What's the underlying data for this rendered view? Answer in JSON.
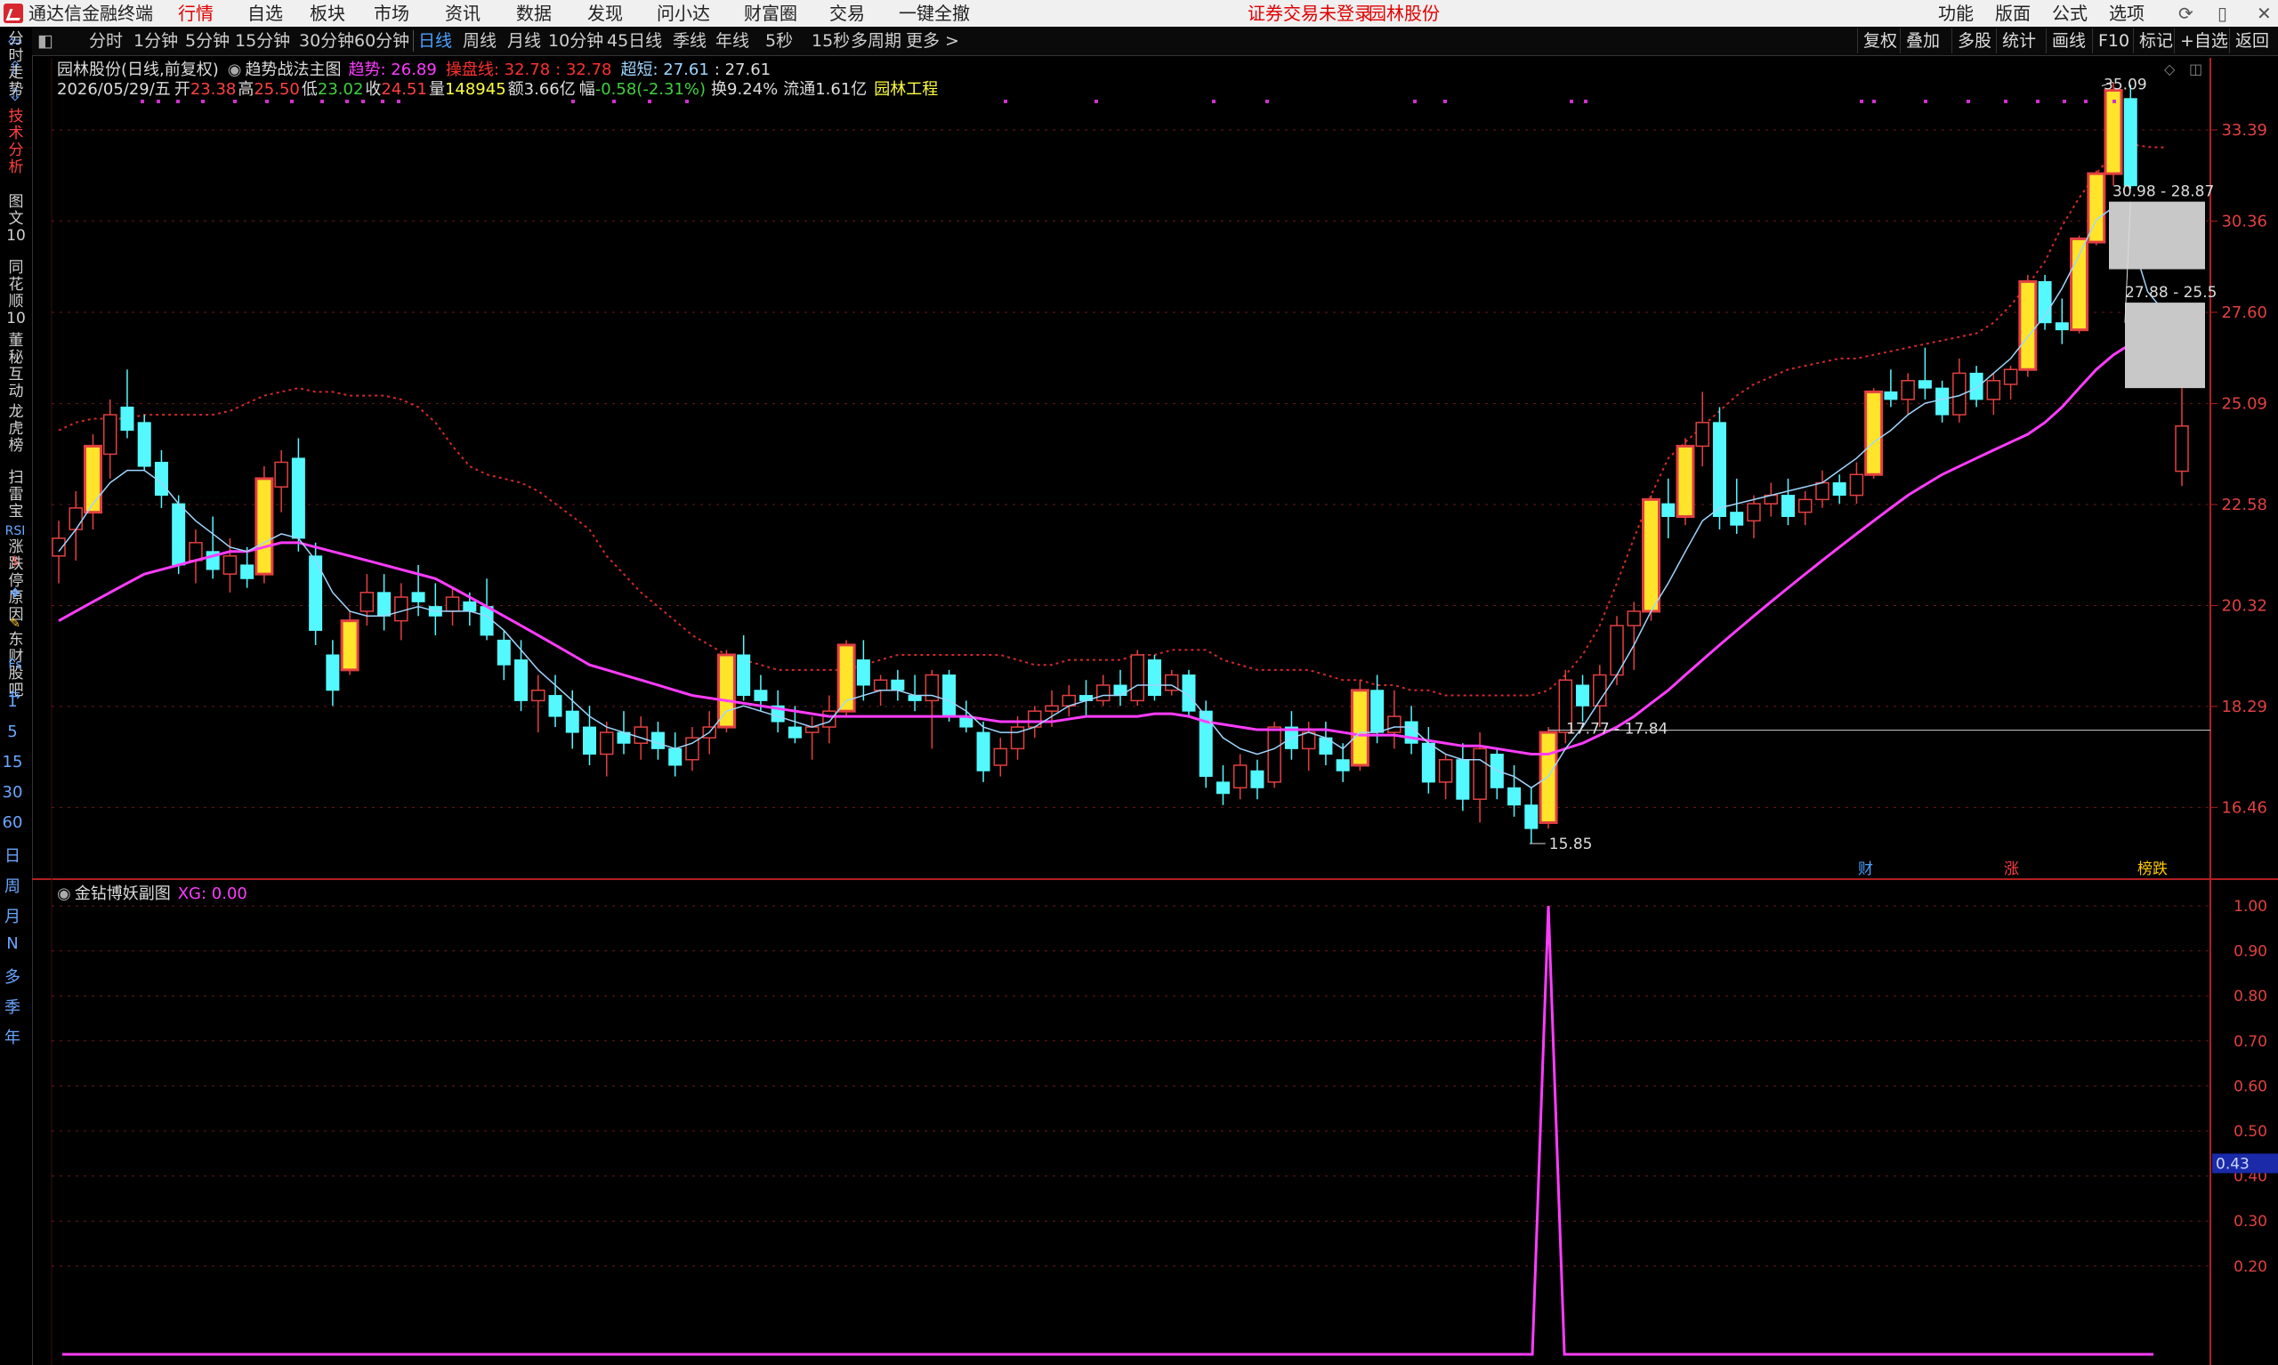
{
  "app": {
    "title": "通达信金融终端",
    "menu": [
      "行情",
      "自选",
      "板块",
      "市场",
      "资讯",
      "数据",
      "发现",
      "问小达",
      "财富圈",
      "交易",
      "一键全撤"
    ],
    "active_menu": "行情",
    "notice": "证券交易未登录",
    "stock_tag": "园林股份",
    "right_menu": [
      "功能",
      "版面",
      "公式",
      "选项"
    ]
  },
  "left_tabs": [
    "分时走势",
    "技术分析",
    "图文10",
    "同花顺10",
    "董秘互动",
    "龙虎榜",
    "扫雷宝",
    "涨跌停原因",
    "东财股吧"
  ],
  "left_active": "技术分析",
  "left_icons": [
    "RSI",
    "$",
    "Fs",
    "F10",
    "F10",
    "F10",
    "F10"
  ],
  "left_periods": [
    "1",
    "5",
    "15",
    "30",
    "60",
    "日",
    "周",
    "月",
    "N",
    "多",
    "季",
    "年"
  ],
  "periods": [
    "分时",
    "1分钟",
    "5分钟",
    "15分钟",
    "30分钟",
    "60分钟",
    "日线",
    "周线",
    "月线",
    "10分钟",
    "45日线",
    "季线",
    "年线",
    "5秒",
    "15秒",
    "多周期",
    "更多 >"
  ],
  "active_period": "日线",
  "right_tools": [
    "复权",
    "叠加",
    "多股",
    "统计",
    "画线",
    "F10",
    "标记",
    "+自选",
    "返回"
  ],
  "header": {
    "stock": "园林股份(日线,前复权)",
    "indicator": "趋势战法主图",
    "trend_label": "趋势: ",
    "trend_val": "26.89",
    "ctrl_label": "操盘线: ",
    "ctrl_val": "32.78",
    "ctrl_val2": ": 32.78",
    "short_label": "超短: ",
    "short_val": "27.61",
    "short_val2": ": 27.61"
  },
  "quote": {
    "date": "2026/05/29/五",
    "open_label": "开",
    "open": "23.38",
    "high_label": "高",
    "high": "25.50",
    "low_label": "低",
    "low": "23.02",
    "close_label": "收",
    "close": "24.51",
    "vol_label": "量",
    "vol": "148945",
    "amt_label": "额",
    "amt": "3.66亿",
    "chg_label": "幅",
    "chg": "-0.58(-2.31%)",
    "turn_label": "换",
    "turn": "9.24%",
    "float_label": "流通",
    "float": "1.61亿",
    "sector": "园林工程"
  },
  "price_axis": [
    "33.39",
    "30.36",
    "27.60",
    "25.09",
    "22.58",
    "20.32",
    "18.29",
    "16.46"
  ],
  "chart_annotations": {
    "high_mark": "35.09",
    "low_mark": "15.85",
    "box1": "30.98 - 28.87",
    "box2": "27.88 - 25.5",
    "line_label": "17.77 - 17.84"
  },
  "event_markers": [
    "财",
    "涨",
    "榜跌"
  ],
  "sub_chart": {
    "name": "金钻博妖副图",
    "xg_label": "XG: 0.00",
    "axis": [
      "1.00",
      "0.90",
      "0.80",
      "0.70",
      "0.60",
      "0.50",
      "0.40",
      "0.30",
      "0.20"
    ],
    "current_value": "0.43"
  },
  "colors": {
    "up_candle": "#e24040",
    "down_candle": "#54f8ff",
    "limit_up_bar": "#ffe42a",
    "ma_main": "#ff3cff",
    "ma_short": "#9fd6ff",
    "band": "#d22a2a"
  },
  "chart_data": {
    "type": "candlestick",
    "title": "园林股份(日线,前复权)",
    "ylim": [
      15.5,
      35.5
    ],
    "candles": [
      [
        21.4,
        22.2,
        20.8,
        21.8,
        0
      ],
      [
        22.0,
        22.9,
        21.3,
        22.5,
        0
      ],
      [
        22.4,
        24.3,
        22.0,
        24.0,
        1
      ],
      [
        23.8,
        25.2,
        23.2,
        24.8,
        0
      ],
      [
        25.0,
        26.0,
        24.2,
        24.4,
        0
      ],
      [
        24.6,
        24.8,
        23.4,
        23.5,
        0
      ],
      [
        23.6,
        23.9,
        22.5,
        22.8,
        0
      ],
      [
        22.6,
        22.8,
        21.0,
        21.2,
        0
      ],
      [
        21.3,
        22.0,
        20.8,
        21.7,
        0
      ],
      [
        21.5,
        22.3,
        20.9,
        21.1,
        0
      ],
      [
        21.0,
        21.8,
        20.6,
        21.4,
        0
      ],
      [
        21.2,
        21.6,
        20.7,
        20.9,
        0
      ],
      [
        21.0,
        23.5,
        20.8,
        23.2,
        1
      ],
      [
        23.0,
        23.9,
        22.4,
        23.6,
        0
      ],
      [
        23.7,
        24.2,
        21.5,
        21.8,
        0
      ],
      [
        21.4,
        21.7,
        19.5,
        19.8,
        0
      ],
      [
        19.3,
        19.6,
        18.3,
        18.6,
        0
      ],
      [
        19.0,
        20.2,
        18.9,
        20.0,
        1
      ],
      [
        20.2,
        21.0,
        19.9,
        20.6,
        0
      ],
      [
        20.6,
        21.0,
        19.8,
        20.1,
        0
      ],
      [
        20.0,
        20.8,
        19.6,
        20.5,
        0
      ],
      [
        20.6,
        21.2,
        20.1,
        20.4,
        0
      ],
      [
        20.3,
        20.8,
        19.7,
        20.1,
        0
      ],
      [
        20.2,
        20.7,
        19.9,
        20.5,
        0
      ],
      [
        20.4,
        20.6,
        19.9,
        20.2,
        0
      ],
      [
        20.3,
        20.9,
        19.6,
        19.7,
        0
      ],
      [
        19.6,
        19.8,
        18.8,
        19.1,
        0
      ],
      [
        19.2,
        19.6,
        18.2,
        18.4,
        0
      ],
      [
        18.4,
        18.9,
        17.8,
        18.6,
        0
      ],
      [
        18.5,
        18.9,
        17.9,
        18.1,
        0
      ],
      [
        18.2,
        18.6,
        17.5,
        17.8,
        0
      ],
      [
        17.9,
        18.3,
        17.2,
        17.4,
        0
      ],
      [
        17.4,
        18.0,
        17.0,
        17.8,
        0
      ],
      [
        17.8,
        18.2,
        17.4,
        17.6,
        0
      ],
      [
        17.6,
        18.1,
        17.3,
        17.9,
        0
      ],
      [
        17.8,
        18.0,
        17.3,
        17.5,
        0
      ],
      [
        17.5,
        17.8,
        17.0,
        17.2,
        0
      ],
      [
        17.3,
        17.9,
        17.1,
        17.7,
        0
      ],
      [
        17.7,
        18.2,
        17.4,
        17.9,
        0
      ],
      [
        17.9,
        19.4,
        17.8,
        19.3,
        1
      ],
      [
        19.3,
        19.7,
        18.4,
        18.5,
        0
      ],
      [
        18.6,
        18.9,
        18.2,
        18.4,
        0
      ],
      [
        18.3,
        18.6,
        17.8,
        18.0,
        0
      ],
      [
        17.9,
        18.3,
        17.6,
        17.7,
        0
      ],
      [
        17.8,
        18.1,
        17.3,
        17.9,
        0
      ],
      [
        17.9,
        18.5,
        17.6,
        18.2,
        0
      ],
      [
        18.2,
        19.6,
        18.1,
        19.5,
        1
      ],
      [
        19.2,
        19.6,
        18.4,
        18.7,
        0
      ],
      [
        18.6,
        18.9,
        18.3,
        18.8,
        0
      ],
      [
        18.8,
        19.0,
        18.4,
        18.6,
        0
      ],
      [
        18.5,
        18.9,
        18.2,
        18.4,
        0
      ],
      [
        18.4,
        19.0,
        17.5,
        18.9,
        0
      ],
      [
        18.9,
        19.0,
        18.0,
        18.1,
        0
      ],
      [
        18.1,
        18.4,
        17.8,
        17.9,
        0
      ],
      [
        17.8,
        18.0,
        16.9,
        17.1,
        0
      ],
      [
        17.2,
        17.7,
        17.0,
        17.5,
        0
      ],
      [
        17.5,
        18.1,
        17.3,
        17.9,
        0
      ],
      [
        17.9,
        18.3,
        17.7,
        18.2,
        0
      ],
      [
        18.2,
        18.6,
        17.9,
        18.3,
        0
      ],
      [
        18.3,
        18.7,
        18.1,
        18.5,
        0
      ],
      [
        18.5,
        18.8,
        18.1,
        18.4,
        0
      ],
      [
        18.4,
        18.9,
        18.3,
        18.7,
        0
      ],
      [
        18.7,
        19.0,
        18.3,
        18.5,
        0
      ],
      [
        18.4,
        19.4,
        18.3,
        19.3,
        0
      ],
      [
        19.2,
        19.3,
        18.4,
        18.5,
        0
      ],
      [
        18.6,
        19.0,
        18.5,
        18.9,
        0
      ],
      [
        18.9,
        19.0,
        18.1,
        18.2,
        0
      ],
      [
        18.2,
        18.4,
        16.8,
        17.0,
        0
      ],
      [
        16.9,
        17.2,
        16.5,
        16.7,
        0
      ],
      [
        16.8,
        17.4,
        16.6,
        17.2,
        0
      ],
      [
        17.1,
        17.3,
        16.6,
        16.8,
        0
      ],
      [
        16.9,
        18.0,
        16.8,
        17.9,
        0
      ],
      [
        17.9,
        18.2,
        17.3,
        17.5,
        0
      ],
      [
        17.5,
        18.0,
        17.1,
        17.8,
        0
      ],
      [
        17.7,
        18.0,
        17.2,
        17.4,
        0
      ],
      [
        17.3,
        17.6,
        16.9,
        17.1,
        0
      ],
      [
        17.2,
        18.8,
        17.1,
        18.6,
        1
      ],
      [
        18.6,
        18.9,
        17.6,
        17.8,
        0
      ],
      [
        17.8,
        18.6,
        17.5,
        18.1,
        0
      ],
      [
        18.0,
        18.3,
        17.4,
        17.6,
        0
      ],
      [
        17.6,
        17.9,
        16.7,
        16.9,
        0
      ],
      [
        16.9,
        17.4,
        16.6,
        17.3,
        0
      ],
      [
        17.3,
        17.6,
        16.4,
        16.6,
        0
      ],
      [
        16.6,
        17.8,
        16.2,
        17.5,
        0
      ],
      [
        17.4,
        17.5,
        16.6,
        16.8,
        0
      ],
      [
        16.8,
        17.2,
        16.3,
        16.5,
        0
      ],
      [
        16.5,
        16.8,
        15.85,
        16.1,
        0
      ],
      [
        16.2,
        17.9,
        16.1,
        17.8,
        1
      ],
      [
        17.8,
        19.0,
        17.6,
        18.8,
        0
      ],
      [
        18.7,
        18.9,
        18.0,
        18.3,
        0
      ],
      [
        18.3,
        19.1,
        17.9,
        18.9,
        0
      ],
      [
        18.9,
        20.1,
        18.7,
        19.9,
        0
      ],
      [
        19.9,
        20.4,
        19.0,
        20.2,
        0
      ],
      [
        20.2,
        22.8,
        20.0,
        22.7,
        1
      ],
      [
        22.6,
        23.2,
        21.8,
        22.3,
        0
      ],
      [
        22.3,
        24.2,
        22.1,
        24.0,
        1
      ],
      [
        24.0,
        25.4,
        23.5,
        24.6,
        0
      ],
      [
        24.6,
        25.0,
        22.0,
        22.3,
        0
      ],
      [
        22.4,
        23.2,
        21.9,
        22.1,
        0
      ],
      [
        22.2,
        22.8,
        21.8,
        22.6,
        0
      ],
      [
        22.6,
        23.1,
        22.3,
        22.8,
        0
      ],
      [
        22.8,
        23.2,
        22.1,
        22.3,
        0
      ],
      [
        22.4,
        22.9,
        22.1,
        22.7,
        0
      ],
      [
        22.7,
        23.4,
        22.5,
        23.1,
        0
      ],
      [
        23.1,
        23.3,
        22.6,
        22.8,
        0
      ],
      [
        22.8,
        23.6,
        22.6,
        23.3,
        0
      ],
      [
        23.3,
        25.5,
        23.2,
        25.4,
        1
      ],
      [
        25.4,
        26.0,
        25.0,
        25.2,
        0
      ],
      [
        25.2,
        25.9,
        24.8,
        25.7,
        0
      ],
      [
        25.7,
        26.6,
        25.2,
        25.5,
        0
      ],
      [
        25.5,
        25.7,
        24.6,
        24.8,
        0
      ],
      [
        24.8,
        26.3,
        24.6,
        25.9,
        0
      ],
      [
        25.9,
        26.1,
        25.0,
        25.2,
        0
      ],
      [
        25.2,
        25.9,
        24.8,
        25.7,
        0
      ],
      [
        25.6,
        26.1,
        25.2,
        26.0,
        0
      ],
      [
        26.0,
        28.7,
        25.8,
        28.5,
        1
      ],
      [
        28.5,
        28.7,
        27.1,
        27.3,
        0
      ],
      [
        27.3,
        28.0,
        26.7,
        27.1,
        0
      ],
      [
        27.1,
        29.9,
        27.0,
        29.8,
        1
      ],
      [
        29.7,
        32.0,
        29.6,
        31.9,
        1
      ],
      [
        31.9,
        35.09,
        31.5,
        34.8,
        1
      ],
      [
        34.5,
        35.0,
        31.4,
        31.5,
        0
      ],
      [
        0,
        0,
        0,
        0,
        2
      ],
      [
        0,
        0,
        0,
        0,
        2
      ],
      [
        23.38,
        25.5,
        23.02,
        24.51,
        3
      ]
    ],
    "ma_main": [
      20.0,
      20.2,
      20.4,
      20.6,
      20.8,
      21.0,
      21.1,
      21.2,
      21.3,
      21.4,
      21.5,
      21.5,
      21.6,
      21.7,
      21.7,
      21.6,
      21.5,
      21.4,
      21.3,
      21.2,
      21.1,
      21.0,
      20.9,
      20.7,
      20.5,
      20.3,
      20.1,
      19.9,
      19.7,
      19.5,
      19.3,
      19.1,
      19.0,
      18.9,
      18.8,
      18.7,
      18.6,
      18.5,
      18.45,
      18.4,
      18.35,
      18.3,
      18.25,
      18.2,
      18.15,
      18.1,
      18.1,
      18.1,
      18.1,
      18.1,
      18.1,
      18.1,
      18.1,
      18.1,
      18.05,
      18.0,
      18.0,
      18.0,
      18.0,
      18.05,
      18.1,
      18.1,
      18.1,
      18.1,
      18.15,
      18.15,
      18.1,
      18.0,
      17.95,
      17.9,
      17.85,
      17.85,
      17.85,
      17.85,
      17.85,
      17.8,
      17.75,
      17.75,
      17.75,
      17.7,
      17.65,
      17.6,
      17.55,
      17.55,
      17.5,
      17.45,
      17.4,
      17.4,
      17.5,
      17.6,
      17.75,
      17.9,
      18.1,
      18.35,
      18.6,
      18.9,
      19.2,
      19.5,
      19.8,
      20.1,
      20.4,
      20.7,
      21.0,
      21.3,
      21.6,
      21.9,
      22.2,
      22.5,
      22.8,
      23.05,
      23.3,
      23.5,
      23.7,
      23.9,
      24.1,
      24.3,
      24.6,
      25.0,
      25.5,
      26.0,
      26.4,
      26.7,
      26.9,
      26.9
    ],
    "ma_short": [
      21.5,
      22.0,
      22.6,
      23.1,
      23.4,
      23.4,
      23.1,
      22.6,
      22.2,
      21.9,
      21.6,
      21.5,
      21.7,
      21.9,
      21.8,
      21.3,
      20.6,
      20.2,
      20.1,
      20.1,
      20.2,
      20.3,
      20.2,
      20.2,
      20.2,
      20.1,
      19.8,
      19.4,
      19.0,
      18.7,
      18.4,
      18.1,
      17.9,
      17.8,
      17.7,
      17.6,
      17.5,
      17.6,
      17.8,
      18.2,
      18.3,
      18.2,
      18.1,
      18.0,
      17.9,
      18.0,
      18.4,
      18.5,
      18.6,
      18.6,
      18.5,
      18.5,
      18.4,
      18.2,
      17.9,
      17.8,
      17.8,
      17.9,
      18.1,
      18.3,
      18.4,
      18.5,
      18.5,
      18.7,
      18.7,
      18.7,
      18.5,
      18.1,
      17.7,
      17.5,
      17.4,
      17.5,
      17.7,
      17.8,
      17.7,
      17.5,
      17.8,
      17.8,
      17.9,
      17.9,
      17.6,
      17.4,
      17.3,
      17.3,
      17.1,
      17.0,
      16.8,
      17.0,
      17.5,
      17.9,
      18.4,
      18.9,
      19.5,
      20.2,
      20.8,
      21.5,
      22.2,
      22.5,
      22.6,
      22.7,
      22.8,
      22.9,
      23.0,
      23.1,
      23.4,
      23.7,
      24.1,
      24.4,
      24.8,
      25.1,
      25.2,
      25.3,
      25.5,
      25.9,
      26.3,
      26.9,
      27.5,
      28.3,
      29.3,
      30.4,
      30.8,
      29.9,
      28.2,
      27.6
    ],
    "band": [
      24.4,
      24.6,
      24.7,
      24.7,
      24.7,
      24.8,
      24.8,
      24.8,
      24.8,
      24.8,
      24.9,
      25.1,
      25.3,
      25.4,
      25.5,
      25.4,
      25.4,
      25.3,
      25.3,
      25.3,
      25.2,
      25.0,
      24.6,
      24.0,
      23.5,
      23.3,
      23.2,
      23.1,
      22.9,
      22.6,
      22.3,
      22.0,
      21.4,
      21.0,
      20.6,
      20.3,
      20.0,
      19.7,
      19.5,
      19.3,
      19.2,
      19.1,
      19.0,
      19.0,
      19.0,
      19.0,
      19.0,
      19.1,
      19.2,
      19.3,
      19.3,
      19.3,
      19.3,
      19.3,
      19.3,
      19.3,
      19.2,
      19.1,
      19.1,
      19.2,
      19.2,
      19.2,
      19.2,
      19.3,
      19.3,
      19.4,
      19.4,
      19.4,
      19.2,
      19.1,
      19.0,
      19.0,
      19.0,
      19.0,
      18.9,
      18.8,
      18.8,
      18.7,
      18.7,
      18.6,
      18.6,
      18.5,
      18.5,
      18.5,
      18.5,
      18.5,
      18.5,
      18.6,
      18.9,
      19.3,
      19.9,
      20.8,
      21.8,
      22.8,
      23.7,
      24.1,
      24.5,
      24.9,
      25.3,
      25.6,
      25.8,
      26.0,
      26.1,
      26.2,
      26.3,
      26.3,
      26.4,
      26.5,
      26.6,
      26.7,
      26.8,
      26.9,
      27.0,
      27.3,
      27.8,
      28.4,
      29.1,
      30.2,
      31.1,
      31.9,
      32.6,
      32.9,
      32.8,
      32.78
    ],
    "xg_spike_index": 87
  }
}
